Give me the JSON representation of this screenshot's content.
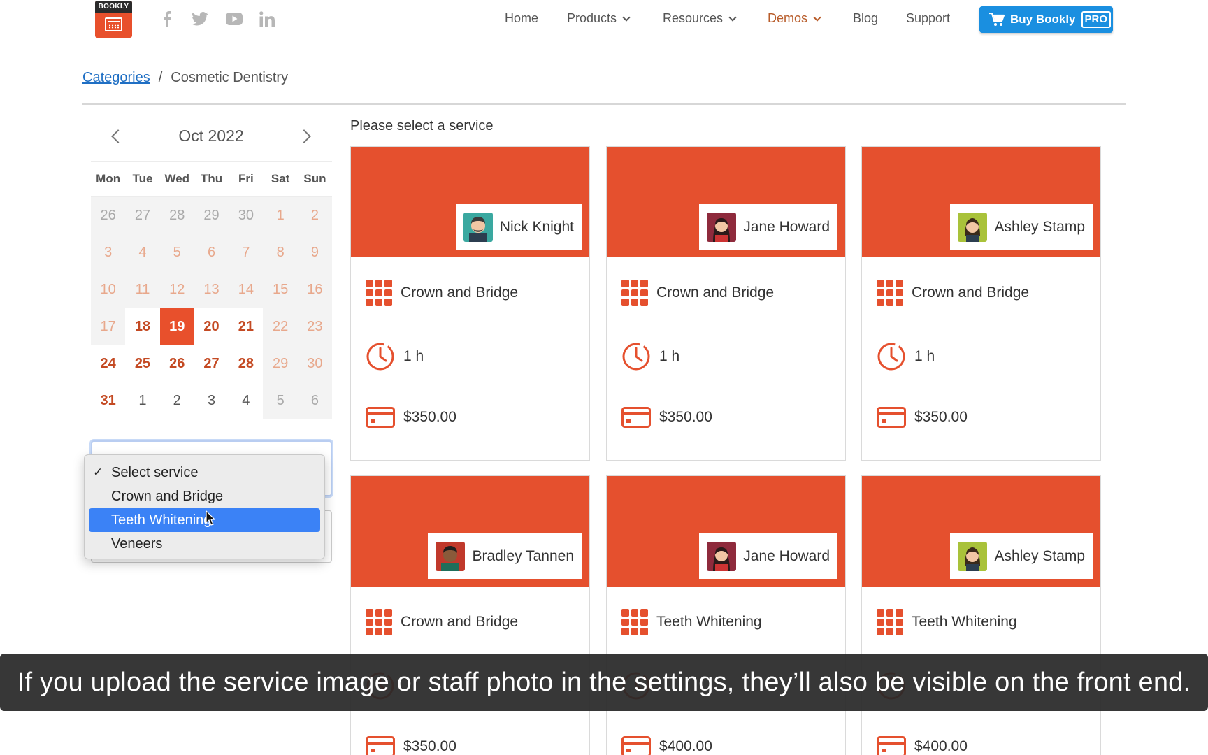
{
  "header": {
    "logo_text": "BOOKLY",
    "social": [
      "facebook-icon",
      "twitter-icon",
      "youtube-icon",
      "linkedin-icon"
    ],
    "nav": [
      {
        "label": "Home",
        "has_menu": false
      },
      {
        "label": "Products",
        "has_menu": true
      },
      {
        "label": "Resources",
        "has_menu": true
      },
      {
        "label": "Demos",
        "has_menu": true,
        "active": true
      },
      {
        "label": "Blog",
        "has_menu": false
      },
      {
        "label": "Support",
        "has_menu": false
      }
    ],
    "buy_label": "Buy Bookly",
    "buy_badge": "PRO",
    "colors": {
      "brand": "#e8502c",
      "buy": "#1a8fe0",
      "active_nav": "#b85c2a"
    }
  },
  "breadcrumb": {
    "root": "Categories",
    "separator": "/",
    "current": "Cosmetic Dentistry"
  },
  "calendar": {
    "month": "Oct 2022",
    "weekdays": [
      "Mon",
      "Tue",
      "Wed",
      "Thu",
      "Fri",
      "Sat",
      "Sun"
    ],
    "weeks": [
      [
        "26",
        "27",
        "28",
        "29",
        "30",
        "1",
        "2"
      ],
      [
        "3",
        "4",
        "5",
        "6",
        "7",
        "8",
        "9"
      ],
      [
        "10",
        "11",
        "12",
        "13",
        "14",
        "15",
        "16"
      ],
      [
        "17",
        "18",
        "19",
        "20",
        "21",
        "22",
        "23"
      ],
      [
        "24",
        "25",
        "26",
        "27",
        "28",
        "29",
        "30"
      ],
      [
        "31",
        "1",
        "2",
        "3",
        "4",
        "5",
        "6"
      ]
    ],
    "selected_day": "19"
  },
  "service_select": {
    "options": [
      "Select service",
      "Crown and Bridge",
      "Teeth Whitening",
      "Veneers"
    ],
    "checked": "Select service",
    "highlighted": "Teeth Whitening"
  },
  "services": {
    "prompt": "Please select a service",
    "cards": [
      {
        "staff": "Nick Knight",
        "service": "Crown and Bridge",
        "duration": "1 h",
        "price": "$350.00"
      },
      {
        "staff": "Jane Howard",
        "service": "Crown and Bridge",
        "duration": "1 h",
        "price": "$350.00"
      },
      {
        "staff": "Ashley Stamp",
        "service": "Crown and Bridge",
        "duration": "1 h",
        "price": "$350.00"
      },
      {
        "staff": "Bradley Tannen",
        "service": "Crown and Bridge",
        "duration": "",
        "price": "$350.00"
      },
      {
        "staff": "Jane Howard",
        "service": "Teeth Whitening",
        "duration": "",
        "price": "$400.00"
      },
      {
        "staff": "Ashley Stamp",
        "service": "Teeth Whitening",
        "duration": "",
        "price": "$400.00"
      }
    ],
    "accent": "#e5502e"
  },
  "caption": "If you upload the service image or staff photo in the settings, they’ll also be visible on the front end."
}
